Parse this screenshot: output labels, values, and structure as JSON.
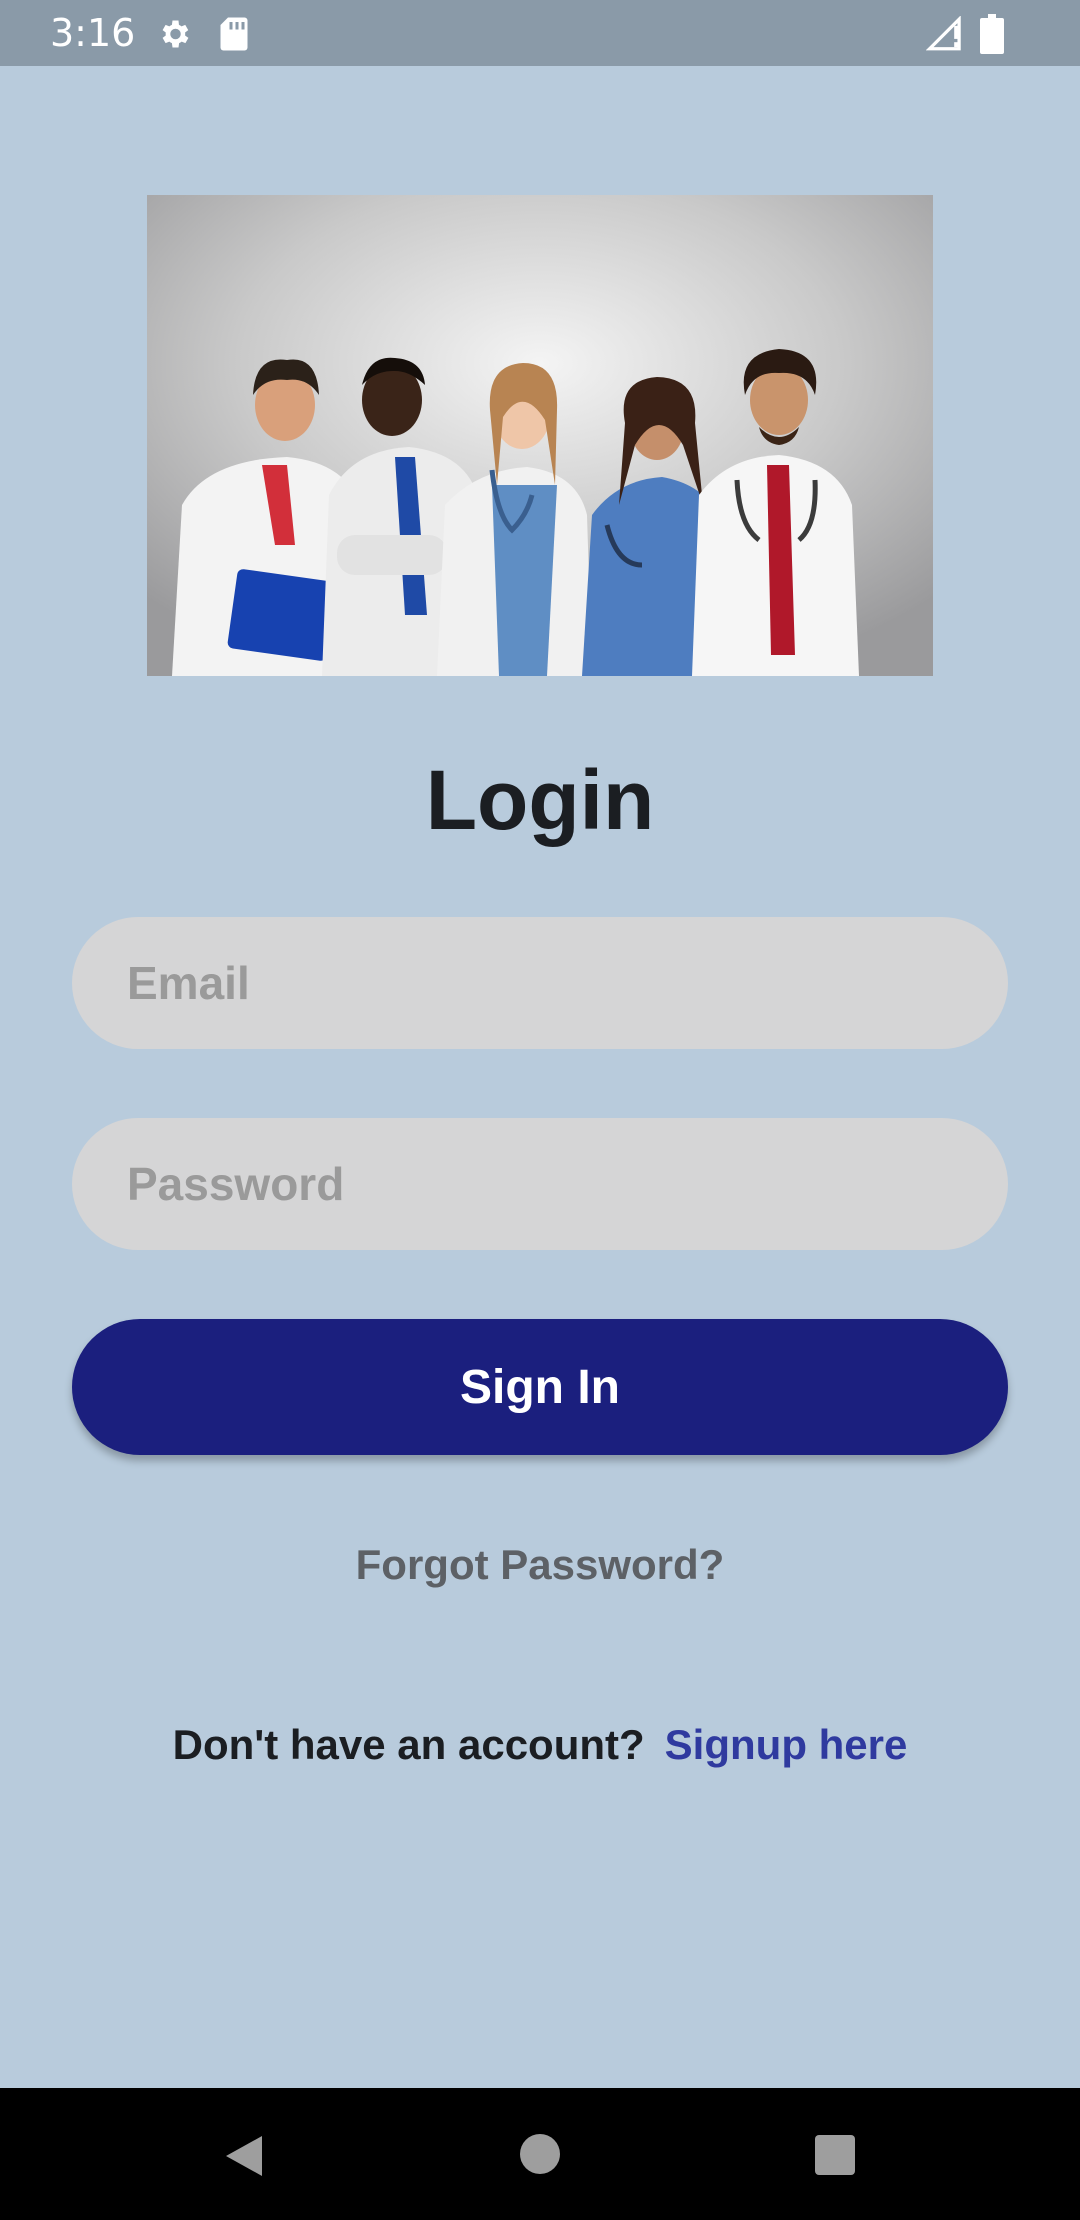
{
  "status_bar": {
    "time": "3:16",
    "icons": [
      "gear-icon",
      "sd-card-icon",
      "signal-icon",
      "battery-icon"
    ]
  },
  "hero": {
    "image": "medical-team-photo"
  },
  "login": {
    "title": "Login",
    "email_placeholder": "Email",
    "password_placeholder": "Password",
    "email_value": "",
    "password_value": "",
    "signin_label": "Sign In",
    "forgot_label": "Forgot Password?",
    "signup_prompt": "Don't have an account?",
    "signup_link": "Signup here"
  },
  "nav_bar": {
    "icons": [
      "back-icon",
      "home-icon",
      "recents-icon"
    ]
  },
  "colors": {
    "background": "#b8cbdc",
    "status_bar": "#8a9aa8",
    "input_bg": "#d5d5d6",
    "button": "#1b1f7e",
    "link": "#2f3a9f",
    "forgot": "#5d6166"
  }
}
